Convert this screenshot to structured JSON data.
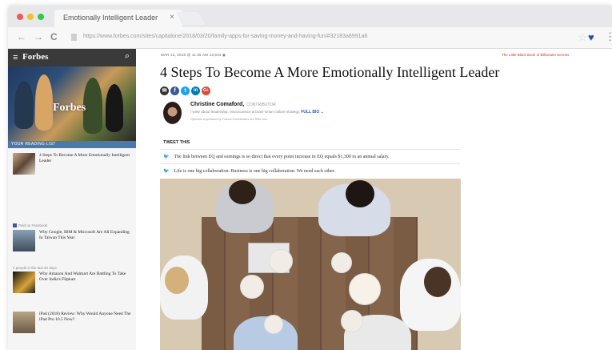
{
  "browser": {
    "tab_title": "Emotionally Intelligent Leader",
    "tab_close": "×",
    "url": "https://www.forbes.com/sites/capitalone/2018/03/20/family-apps-for-saving-money-and-having-fun/#32183a6991a8",
    "nav": {
      "back": "←",
      "forward": "→",
      "reload": "C"
    },
    "star": "☆",
    "extension_icon": "♥",
    "menu": "⋮"
  },
  "sidebar": {
    "brand": "Forbes",
    "hero_logo": "Forbes",
    "reading_list_label": "YOUR READING LIST",
    "items": [
      {
        "title": "4 Steps To Become A More Emotionally Intelligent Leader",
        "kicker": ""
      },
      {
        "title": "Why Google, IBM & Microsoft Are All Expanding In Taiwan This Year",
        "kicker": "Paid on Facebook"
      },
      {
        "title": "Why Amazon And Walmart Are Battling To Take Over India's Flipkart",
        "kicker": "4 people in the last 30 days"
      },
      {
        "title": "iPad (2018) Review: Why Would Anyone Need The iPad Pro 10.5 Now?",
        "kicker": ""
      }
    ]
  },
  "article": {
    "meta_left": "MAR 13, 2018 @ 11:26 AM    13,543 ◉",
    "meta_right": "The Little Black Book of Billionaire Secrets",
    "headline": "4 Steps To Become A More Emotionally Intelligent Leader",
    "share_icons": [
      "✉",
      "f",
      "t",
      "in",
      "G+"
    ],
    "author": "Christine Comaford,",
    "author_role": "CONTRIBUTOR",
    "bio": "I write about leadership, neuroscience & brain-smart culture strategy.",
    "full_bio": "FULL BIO ⌄",
    "disclaimer": "Opinions expressed by Forbes Contributors are their own.",
    "tweet_this": "TWEET THIS",
    "tweets": [
      "The link between EQ and earnings is so direct that every point increase in EQ equals $1,300 to an annual salary.",
      "Life is one big collaboration. Business is one big collaboration. We need each other."
    ]
  },
  "colors": {
    "accent": "#2a5db0",
    "twitter": "#1da1f2",
    "facebook": "#3b5998",
    "forbes_red": "#c0392b"
  }
}
